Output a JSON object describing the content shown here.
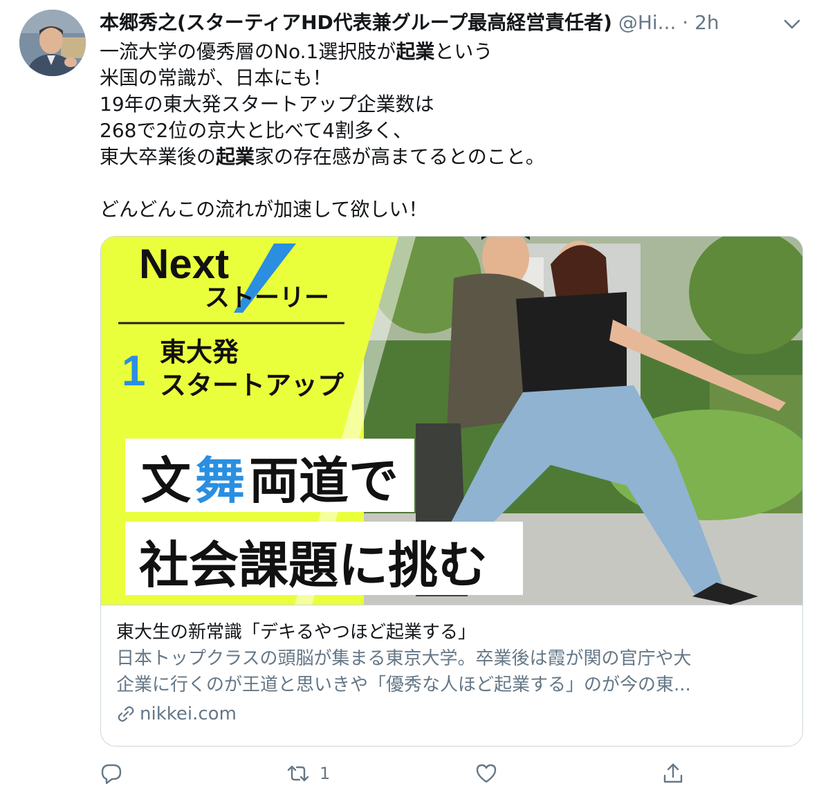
{
  "tweet": {
    "author_name": "本郷秀之(スターティアHD代表兼グループ最高経営責任者)",
    "handle": "@Hi...",
    "separator": "·",
    "time": "2h",
    "lines": [
      {
        "pre": "一流大学の優秀層のNo.1選択肢が",
        "bold": "起業",
        "post": "という"
      },
      {
        "pre": "米国の常識が、日本にも！",
        "bold": "",
        "post": ""
      },
      {
        "pre": "19年の東大発スタートアップ企業数は",
        "bold": "",
        "post": ""
      },
      {
        "pre": "268で2位の京大と比べて4割多く、",
        "bold": "",
        "post": ""
      },
      {
        "pre": "東大卒業後の",
        "bold": "起業",
        "post": "家の存在感が高まてるとのこと。"
      },
      {
        "pre": "",
        "bold": "",
        "post": ""
      },
      {
        "pre": "どんどんこの流れが加速して欲しい！",
        "bold": "",
        "post": ""
      }
    ]
  },
  "card": {
    "image": {
      "logo_word": "Next",
      "logo_sub": "ストーリー",
      "series_number": "1",
      "series_line1": "東大発",
      "series_line2": "スタートアップ",
      "headline1_a": "文",
      "headline1_b": "舞",
      "headline1_c": "両道で",
      "headline2": "社会課題に挑む",
      "yellow": "#eaff3c",
      "blue": "#2a8fe0"
    },
    "title": "東大生の新常識「デキるやつほど起業する」",
    "desc_line1": "日本トップクラスの頭脳が集まる東京大学。卒業後は霞が関の官庁や大",
    "desc_line2": "企業に行くのが王道と思いきや「優秀な人ほど起業する」のが今の東...",
    "domain": "nikkei.com"
  },
  "actions": {
    "reply_count": "",
    "retweet_count": "1",
    "like_count": "",
    "icons": [
      "reply-icon",
      "retweet-icon",
      "like-icon",
      "share-icon"
    ]
  },
  "colors": {
    "text": "#14171a",
    "secondary": "#657786",
    "border": "#ccd6dd"
  }
}
